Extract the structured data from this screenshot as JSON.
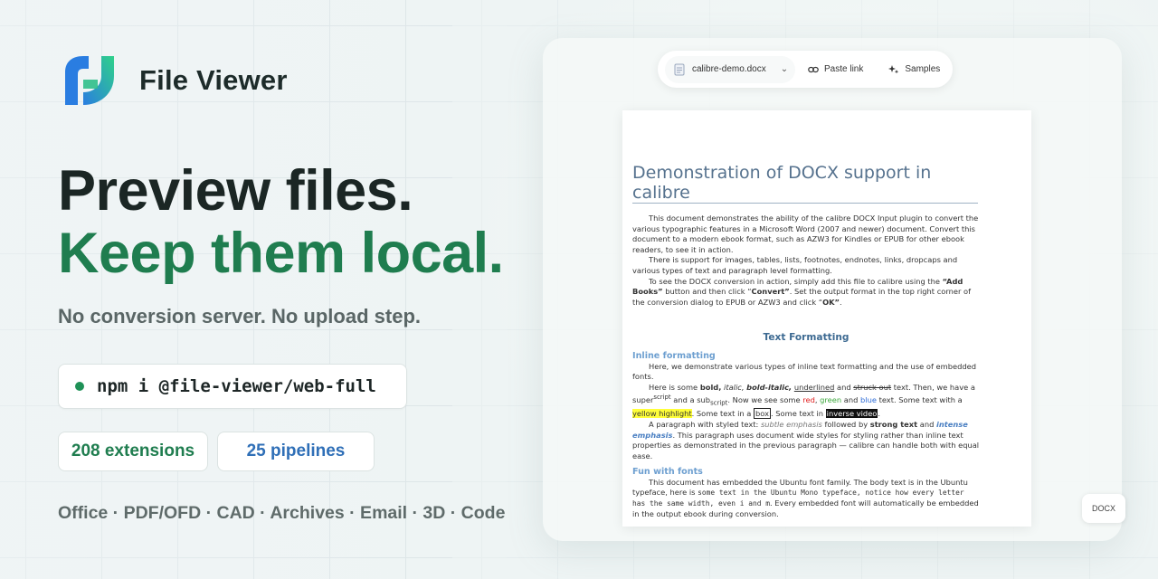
{
  "brand": {
    "name": "File Viewer",
    "logo_colors": [
      "#2fd18a",
      "#2a7de1"
    ]
  },
  "hero": {
    "line1": "Preview files.",
    "line2": "Keep them local.",
    "subtitle": "No conversion server. No upload step."
  },
  "install": {
    "command": "npm i @file-viewer/web-full"
  },
  "stats": {
    "extensions": "208 extensions",
    "pipelines": "25 pipelines"
  },
  "formats": "Office · PDF/OFD · CAD · Archives · Email · 3D · Code",
  "toolbar": {
    "file_name": "calibre-demo.docx",
    "paste_link": "Paste link",
    "samples": "Samples"
  },
  "document": {
    "title": "Demonstration of DOCX support in calibre",
    "p1_a": "This document ",
    "p1_b": "demonstrates the ability of the calibre DOCX Input plugin to convert the various typographic features in a Microsoft Word (2007 and newer) document. Convert this document to a modern ebook format, such as AZW3 for Kindles or EPUB for other ebook readers, to see it in action.",
    "p2": "There is support for images, tables, lists, footnotes, endnotes, links, dropcaps and various types of text and paragraph level formatting.",
    "p3_a": "To see the DOCX conversion in action, simply add this file to calibre using the ",
    "p3_b": "“Add Books”",
    "p3_c": " button and then click “",
    "p3_d": "Convert”",
    "p3_e": ". Set the output format in the top right corner of the conversion dialog to EPUB or AZW3 and click “",
    "p3_f": "OK”",
    "p3_g": ".",
    "section": "Text Formatting",
    "inline_head": "Inline formatting",
    "p4": "Here, we demonstrate various types of inline text formatting and the use of embedded fonts.",
    "p5_a": "Here is some ",
    "p5_bold": "bold,",
    "p5_italic": "italic,",
    "p5_bi": "bold-italic,",
    "p5_under": "underlined",
    "p5_and": " and ",
    "p5_strike": "struck out",
    "p5_b": " text. Then, we have a super",
    "p5_sup": "script",
    "p5_c": " and a sub",
    "p5_sub": "script",
    "p5_d": ". Now we see some ",
    "p5_red": "red",
    "p5_green": "green",
    "p5_e": " and ",
    "p5_blue": "blue",
    "p5_f": " text. Some text with a ",
    "p5_yellow": "yellow highlight",
    "p5_g": ". Some text in a ",
    "p5_box": "box",
    "p5_h": ". Some text in ",
    "p5_inv": "inverse video",
    "p5_i": ".",
    "p6_a": "A paragraph with styled text: ",
    "p6_subtle": "subtle emphasis",
    "p6_b": " followed by ",
    "p6_strong": "strong text",
    "p6_c": " and ",
    "p6_intense": "intense emphasis",
    "p6_d": ". This paragraph uses document wide styles for styling rather than inline text properties as demonstrated in the previous paragraph — calibre can handle both with equal ease.",
    "fonts_head": "Fun with fonts",
    "p7_a": "This document has embedded the Ubuntu font family. The body text is in the Ubuntu typeface, here is ",
    "p7_mono": "some text in the Ubuntu Mono typeface, notice how every letter has the same width, even i and m",
    "p7_b": ". Every embedded font will automatically be embedded in the output ebook during conversion."
  },
  "badge": "DOCX"
}
